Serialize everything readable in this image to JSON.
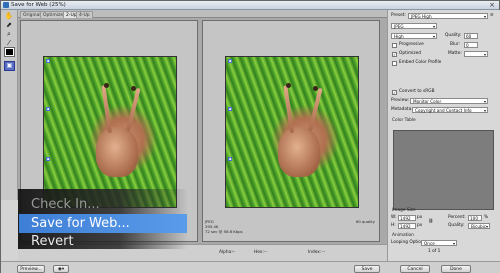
{
  "window": {
    "title": "Save for Web (25%)"
  },
  "tabs": [
    "Original",
    "Optimized",
    "2-Up",
    "4-Up"
  ],
  "panes": {
    "right": {
      "format": "JPEG",
      "size": "295.4K",
      "time": "72 sec @ 56.6 Kbps",
      "quality_label": "60 quality"
    }
  },
  "settings": {
    "preset_label": "Preset:",
    "preset_value": "JPEG High",
    "format_value": "JPEG",
    "compression_value": "High",
    "quality_label": "Quality:",
    "quality_value": "60",
    "blur_label": "Blur:",
    "blur_value": "0",
    "matte_label": "Matte:",
    "progressive_label": "Progressive",
    "optimized_label": "Optimized",
    "embed_profile_label": "Embed Color Profile",
    "convert_srgb_label": "Convert to sRGB",
    "preview_label": "Preview:",
    "preview_value": "Monitor Color",
    "metadata_label": "Metadata:",
    "metadata_value": "Copyright and Contact Info",
    "color_table_label": "Color Table",
    "image_size_label": "Image Size",
    "w_label": "W:",
    "w_value": "1492",
    "h_label": "H:",
    "h_value": "1492",
    "px_unit": "px",
    "percent_label": "Percent:",
    "percent_value": "100",
    "quality2_label": "Quality:",
    "quality2_value": "Bicubic",
    "animation_label": "Animation",
    "looping_label": "Looping Options:",
    "looping_value": "Once",
    "frame_counter": "1 of 1"
  },
  "bottombar": {
    "alpha_label": "Alpha:",
    "alpha_value": "--",
    "hex_label": "Hex:",
    "hex_value": "--",
    "index_label": "Index:",
    "index_value": "--"
  },
  "footer": {
    "preview_button": "Preview...",
    "save_button": "Save",
    "cancel_button": "Cancel",
    "done_button": "Done"
  },
  "menu": {
    "items": [
      "Check In...",
      "Save for Web...",
      "Revert"
    ]
  },
  "colors": {
    "menu_highlight": "#4a8be0",
    "active_tool": "#5a6dc4"
  }
}
